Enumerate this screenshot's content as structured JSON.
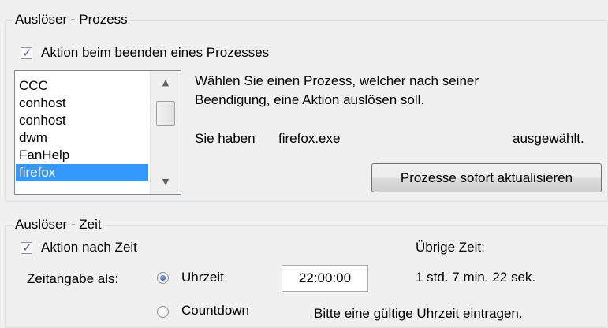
{
  "process_trigger": {
    "group_title": "Auslöser - Prozess",
    "checkbox_label": "Aktion beim beenden eines Prozesses",
    "checkbox_checked": true,
    "process_list": [
      "CCC",
      "conhost",
      "conhost",
      "dwm",
      "FanHelp",
      "firefox"
    ],
    "selected_process": "firefox",
    "description": "Wählen Sie einen Prozess, welcher nach seiner Beendigung, eine Aktion auslösen soll.",
    "description_line1": "Wählen Sie einen Prozess, welcher nach seiner",
    "description_line2": "Beendigung, eine Aktion auslösen soll.",
    "selected_prefix": "Sie haben",
    "selected_value": "firefox.exe",
    "selected_suffix": "ausgewählt.",
    "refresh_button": "Prozesse sofort aktualisieren"
  },
  "time_trigger": {
    "group_title": "Auslöser - Zeit",
    "checkbox_label": "Aktion nach Zeit",
    "checkbox_checked": true,
    "remaining_label": "Übrige Zeit:",
    "remaining_value": "1 std. 7 min. 22 sek.",
    "format_label": "Zeitangabe als:",
    "radio_clock": "Uhrzeit",
    "radio_countdown": "Countdown",
    "selected_mode": "Uhrzeit",
    "time_value": "22:00:00",
    "hint": "Bitte eine gültige Uhrzeit eintragen."
  },
  "icons": {
    "check": "✓",
    "scroll_up": "▲",
    "scroll_down": "▼"
  },
  "colors": {
    "selection": "#3399ff",
    "check_mark": "#4a5f97",
    "radio_dot": "#1e4f98"
  }
}
